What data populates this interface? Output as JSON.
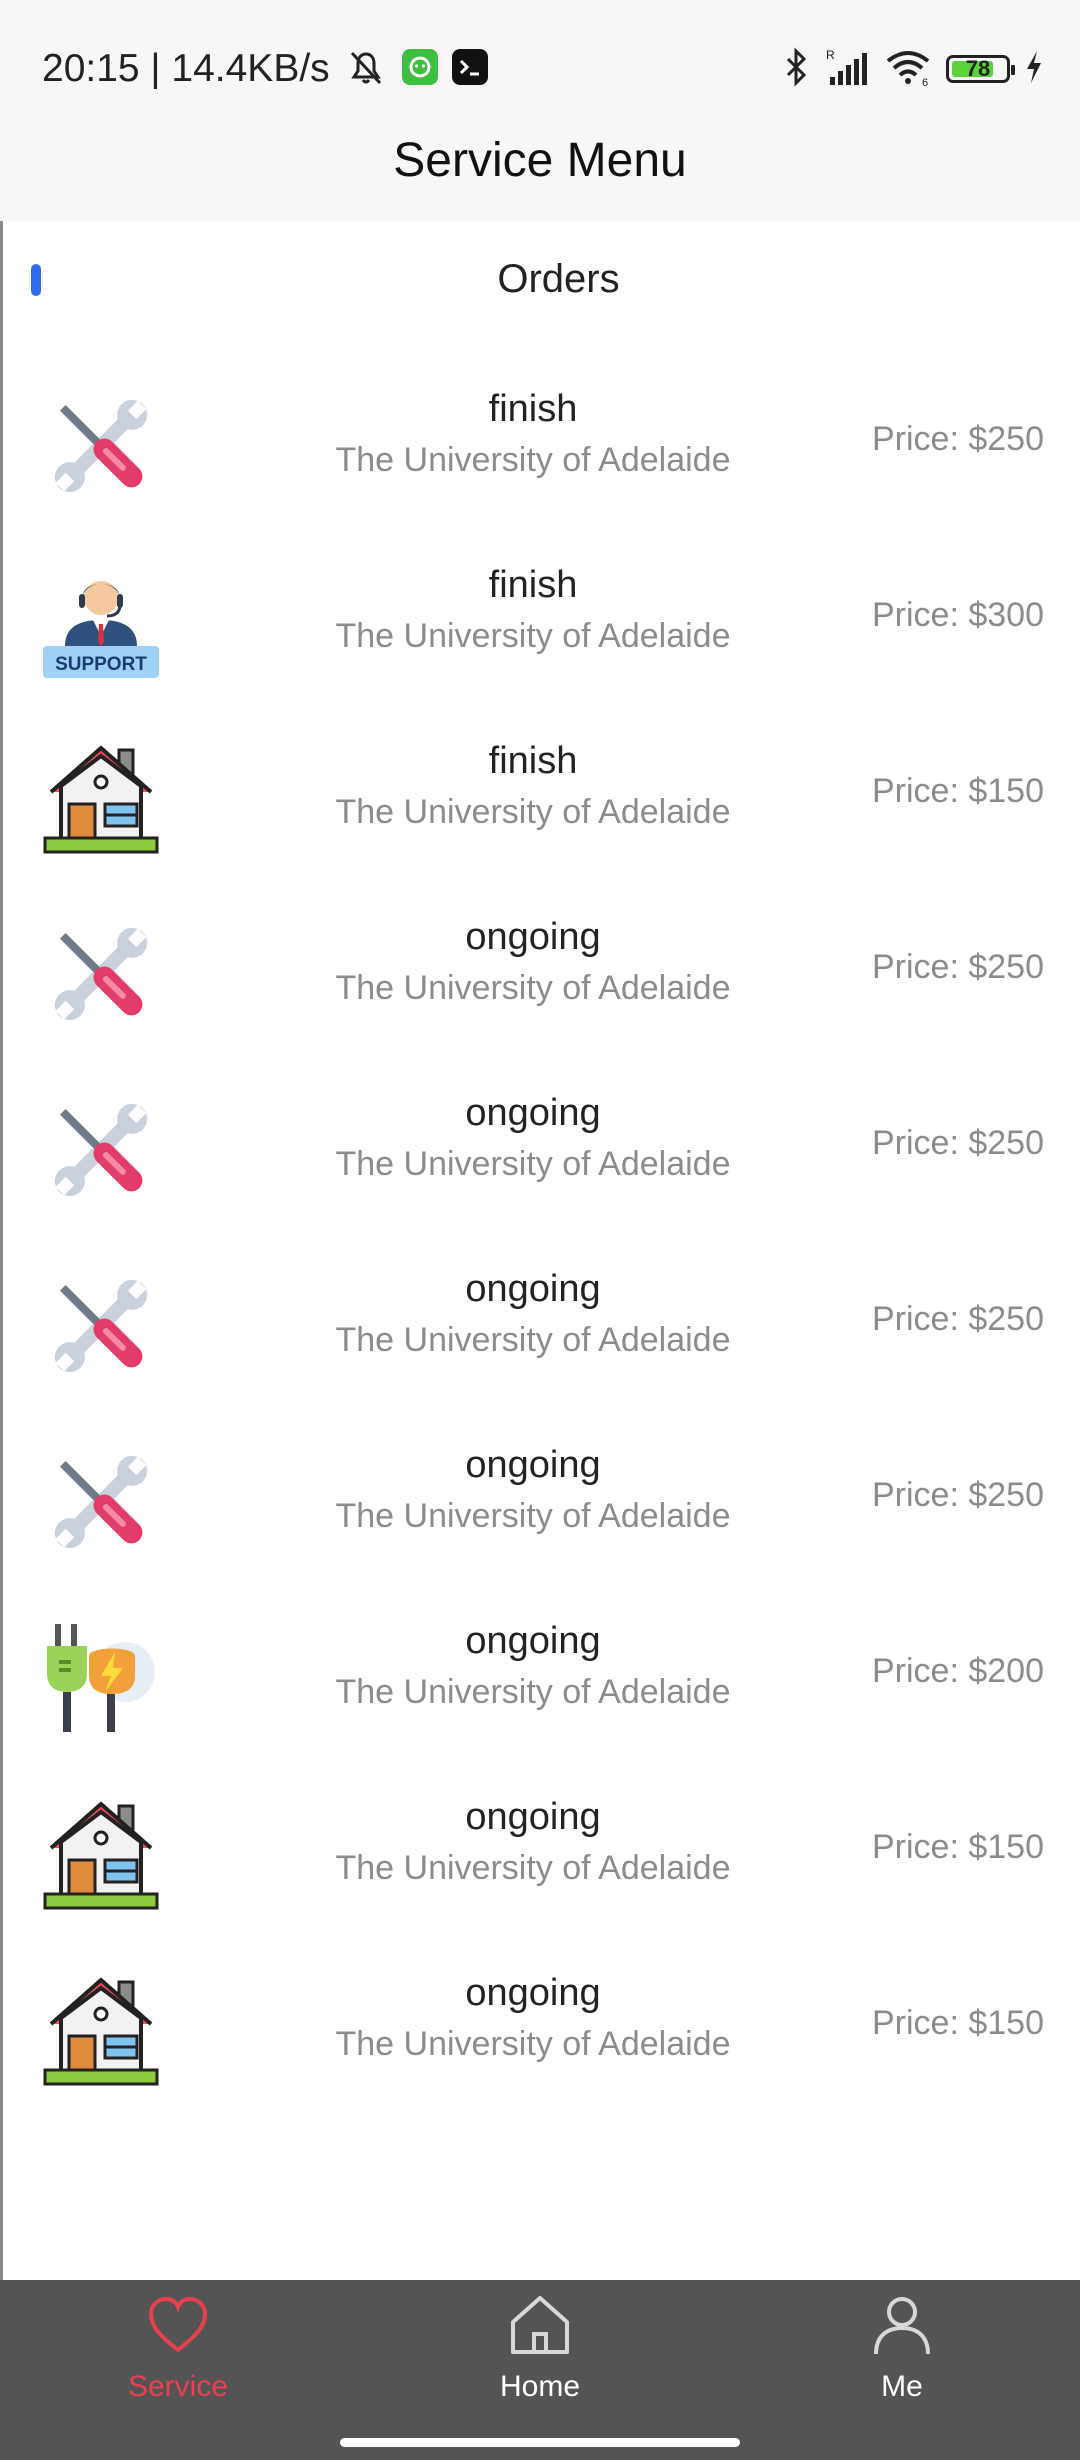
{
  "status_bar": {
    "time_speed": "20:15 | 14.4KB/s",
    "battery_level": "78",
    "battery_fill_percent": 78,
    "battery_color": "#5bd13b"
  },
  "app_bar": {
    "title": "Service Menu"
  },
  "section": {
    "title": "Orders",
    "indicator_color": "#2f6cf0"
  },
  "orders": [
    {
      "icon": "tools-icon",
      "status": "finish",
      "location": "The University of Adelaide",
      "price": "Price: $250"
    },
    {
      "icon": "support-icon",
      "status": "finish",
      "location": "The University of Adelaide",
      "price": "Price: $300"
    },
    {
      "icon": "house-icon",
      "status": "finish",
      "location": "The University of Adelaide",
      "price": "Price: $150"
    },
    {
      "icon": "tools-icon",
      "status": "ongoing",
      "location": "The University of Adelaide",
      "price": "Price: $250"
    },
    {
      "icon": "tools-icon",
      "status": "ongoing",
      "location": "The University of Adelaide",
      "price": "Price: $250"
    },
    {
      "icon": "tools-icon",
      "status": "ongoing",
      "location": "The University of Adelaide",
      "price": "Price: $250"
    },
    {
      "icon": "tools-icon",
      "status": "ongoing",
      "location": "The University of Adelaide",
      "price": "Price: $250"
    },
    {
      "icon": "electric-plug-icon",
      "status": "ongoing",
      "location": "The University of Adelaide",
      "price": "Price: $200"
    },
    {
      "icon": "house-icon",
      "status": "ongoing",
      "location": "The University of Adelaide",
      "price": "Price: $150"
    },
    {
      "icon": "house-icon",
      "status": "ongoing",
      "location": "The University of Adelaide",
      "price": "Price: $150"
    }
  ],
  "bottom_nav": {
    "items": [
      {
        "label": "Service",
        "icon": "heart-icon",
        "active": true,
        "color": "#e8404f"
      },
      {
        "label": "Home",
        "icon": "home-icon",
        "active": false,
        "color": "#ffffff"
      },
      {
        "label": "Me",
        "icon": "person-icon",
        "active": false,
        "color": "#ffffff"
      }
    ],
    "background": "#545454"
  }
}
